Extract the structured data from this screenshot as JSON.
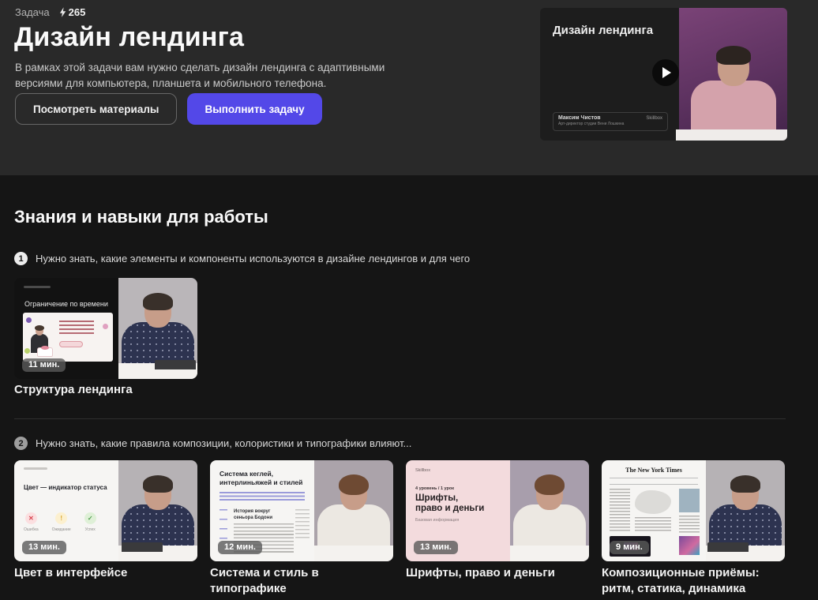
{
  "header": {
    "task_label": "Задача",
    "points": "265",
    "title": "Дизайн лендинга",
    "description": "В рамках этой задачи вам нужно сделать дизайн лендинга с адаптивными версиями для компьютера, планшета и мобильного телефона.",
    "materials_button": "Посмотреть материалы",
    "execute_button": "Выполнить задачу",
    "video": {
      "title": "Дизайн лендинга",
      "author": "Максим Чистов",
      "author_role": "Арт-директор студии Вени Лошкина",
      "brand": "Skillbox"
    }
  },
  "main": {
    "section_title": "Знания и навыки для работы",
    "groups": [
      {
        "number": "1",
        "text": "Нужно знать, какие элементы и компоненты используются в дизайне лендингов и для чего",
        "videos": [
          {
            "duration": "11 мин.",
            "title": "Структура лендинга",
            "slide_title": "Ограничение по времени"
          }
        ]
      },
      {
        "number": "2",
        "text": "Нужно знать, какие правила композиции, колористики и типографики влияют...",
        "videos": [
          {
            "duration": "13 мин.",
            "title": "Цвет в интерфейсе",
            "slide_title": "Цвет — индикатор статуса",
            "status_labels": [
              "Ошибка",
              "Ожидание",
              "Успех"
            ]
          },
          {
            "duration": "12 мин.",
            "title": "Система и стиль в типографике",
            "slide_title": "Система кеглей, интерлиньяжей и стилей",
            "slide_heading": "История вокруг сеньора Бодони"
          },
          {
            "duration": "13 мин.",
            "title": "Шрифты, право и деньги",
            "slide_brand": "Skillbox",
            "slide_label": "4 уровень / 1 урок",
            "slide_title": "Шрифты, право и деньги",
            "slide_subtitle": "Базовая информация"
          },
          {
            "duration": "9 мин.",
            "title": "Композиционные приёмы: ритм, статика, динамика",
            "slide_masthead": "The New York Times"
          }
        ]
      }
    ]
  },
  "colors": {
    "header_bg": "#292929",
    "page_bg": "#151515",
    "primary_button": "#5348e8",
    "badge_bg": "#5a5a5a",
    "pink_slide": "#f3dbdd"
  }
}
